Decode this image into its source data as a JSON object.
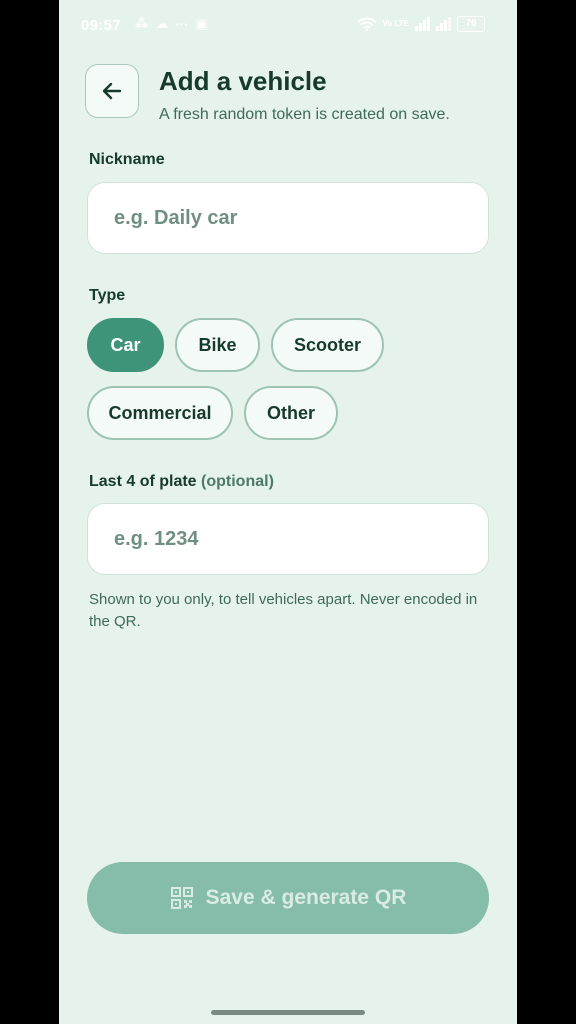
{
  "status_bar": {
    "time": "09:57",
    "battery": "76",
    "network_label": "Vo LTE"
  },
  "header": {
    "title": "Add a vehicle",
    "subtitle": "A fresh random token is created on save."
  },
  "nickname": {
    "label": "Nickname",
    "value": "",
    "placeholder": "e.g. Daily car"
  },
  "type": {
    "label": "Type",
    "options": [
      "Car",
      "Bike",
      "Scooter",
      "Commercial",
      "Other"
    ],
    "selected": "Car"
  },
  "plate": {
    "label": "Last 4 of plate",
    "optional_label": "(optional)",
    "value": "",
    "placeholder": "e.g. 1234",
    "helper": "Shown to you only, to tell vehicles apart. Never encoded in the QR."
  },
  "save_button": {
    "label": "Save & generate QR",
    "icon": "qr-code-icon"
  },
  "colors": {
    "background": "#e6f2ec",
    "accent": "#3e9479",
    "disabled_button": "#86bcaa",
    "text_dark": "#163a2c"
  }
}
